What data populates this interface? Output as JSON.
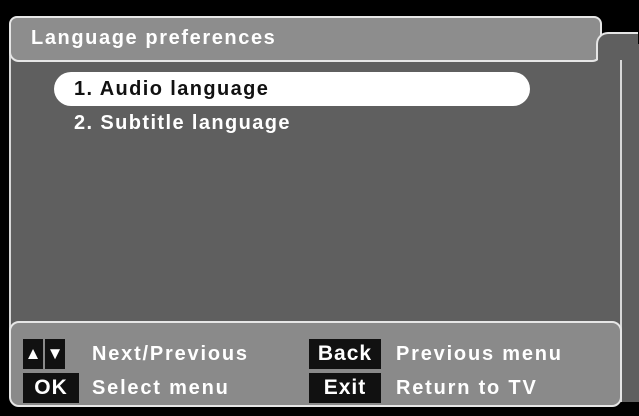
{
  "title": "Language preferences",
  "menu": {
    "items": [
      {
        "label": "1. Audio language",
        "selected": true
      },
      {
        "label": "2. Subtitle language",
        "selected": false
      }
    ]
  },
  "footer": {
    "up_key": "▲",
    "down_key": "▼",
    "nav_hint": "Next/Previous",
    "back_key": "Back",
    "back_hint": "Previous menu",
    "ok_key": "OK",
    "ok_hint": "Select menu",
    "exit_key": "Exit",
    "exit_hint": "Return to TV"
  },
  "colors": {
    "panel": "#5f5f5f",
    "title_bar": "#8d8d8d",
    "footer": "#8a8a8a",
    "highlight": "#ffffff",
    "key_bg": "#111111"
  }
}
